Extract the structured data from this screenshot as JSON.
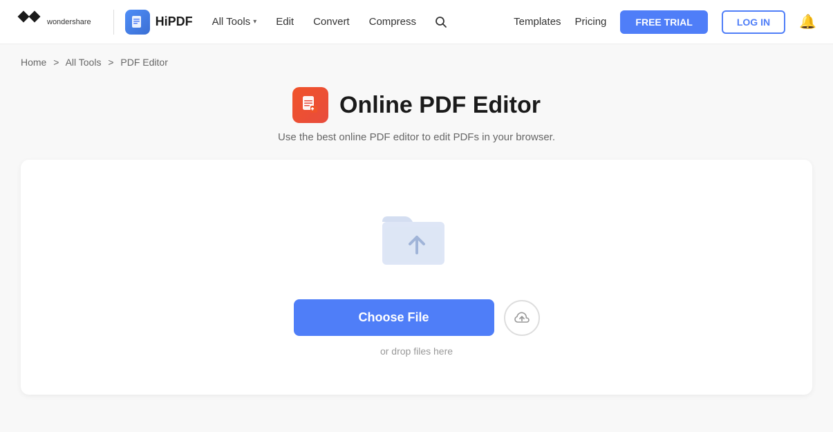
{
  "navbar": {
    "wondershare_text": "wondershare",
    "hipdf_label": "HiPDF",
    "all_tools_label": "All Tools",
    "edit_label": "Edit",
    "convert_label": "Convert",
    "compress_label": "Compress",
    "templates_label": "Templates",
    "pricing_label": "Pricing",
    "free_trial_label": "FREE TRIAL",
    "login_label": "LOG IN"
  },
  "breadcrumb": {
    "home": "Home",
    "all_tools": "All Tools",
    "current": "PDF Editor",
    "sep1": ">",
    "sep2": ">"
  },
  "page": {
    "title": "Online PDF Editor",
    "subtitle": "Use the best online PDF editor to edit PDFs in your browser."
  },
  "upload": {
    "choose_file_label": "Choose File",
    "drop_hint": "or drop files here"
  }
}
